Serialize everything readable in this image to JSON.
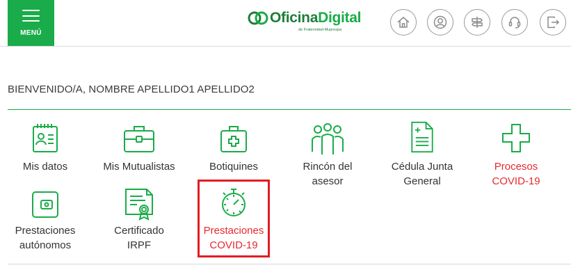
{
  "header": {
    "menu_label": "MENÚ",
    "logo": {
      "brand_part1": "Oficina",
      "brand_part2": "Digital",
      "tagline": "de Fraternidad-Muprespa"
    },
    "icons": [
      "home-icon",
      "user-icon",
      "signpost-icon",
      "headset-icon",
      "logout-icon"
    ]
  },
  "welcome_text": "BIENVENIDO/A, NOMBRE APELLIDO1 APELLIDO2",
  "tiles": [
    {
      "label_lines": [
        "Mis datos"
      ],
      "icon": "id-card-icon"
    },
    {
      "label_lines": [
        "Mis Mutualistas"
      ],
      "icon": "briefcase-icon"
    },
    {
      "label_lines": [
        "Botiquines"
      ],
      "icon": "first-aid-kit-icon"
    },
    {
      "label_lines": [
        "Rincón del",
        "asesor"
      ],
      "icon": "group-people-icon"
    },
    {
      "label_lines": [
        "Cédula Junta",
        "General"
      ],
      "icon": "document-plus-icon"
    },
    {
      "label_lines": [
        "Procesos",
        "COVID-19"
      ],
      "icon": "medical-cross-icon"
    },
    {
      "label_lines": [
        "Prestaciones",
        "autónomos"
      ],
      "icon": "wallet-icon"
    },
    {
      "label_lines": [
        "Certificado IRPF"
      ],
      "icon": "certificate-icon"
    },
    {
      "label_lines": [
        "Prestaciones",
        "COVID-19"
      ],
      "icon": "stopwatch-icon"
    }
  ],
  "colors": {
    "brand_green": "#1aab4a",
    "dark_green": "#1e7d3a",
    "alert_red": "#e8282d",
    "highlight_red": "#e31b23"
  }
}
